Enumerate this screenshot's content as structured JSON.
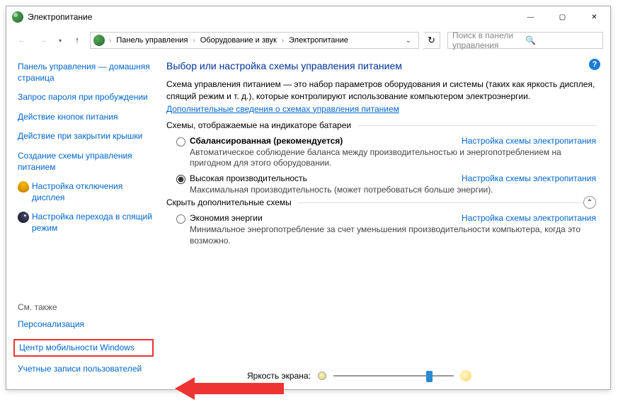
{
  "window_title": "Электропитание",
  "breadcrumb": {
    "items": [
      "Панель управления",
      "Оборудование и звук",
      "Электропитание"
    ]
  },
  "search": {
    "placeholder": "Поиск в панели управления"
  },
  "sidebar": {
    "links": [
      "Панель управления — домашняя страница",
      "Запрос пароля при пробуждении",
      "Действие кнопок питания",
      "Действие при закрытии крышки",
      "Создание схемы управления питанием"
    ],
    "icon_links": [
      "Настройка отключения дисплея",
      "Настройка перехода в спящий режим"
    ],
    "see_also_label": "См. также",
    "see_also_items": [
      "Персонализация",
      "Центр мобильности Windows",
      "Учетные записи пользователей"
    ]
  },
  "main": {
    "title": "Выбор или настройка схемы управления питанием",
    "description": "Схема управления питанием — это набор параметров оборудования и системы (таких как яркость дисплея, спящий режим и т. д.), которые контролируют использование компьютером электроэнергии.",
    "learn_more": "Дополнительные сведения о схемах управления питанием",
    "group1_label": "Схемы, отображаемые на индикаторе батареи",
    "group2_label": "Скрыть дополнительные схемы",
    "plan_link_text": "Настройка схемы электропитания",
    "plans": {
      "balanced": {
        "name": "Сбалансированная (рекомендуется)",
        "desc": "Автоматическое соблюдение баланса между производительностью и энергопотреблением на пригодном для этого оборудовании."
      },
      "high": {
        "name": "Высокая производительность",
        "desc": "Максимальная производительность (может потребоваться больше энергии)."
      },
      "saver": {
        "name": "Экономия энергии",
        "desc": "Минимальное энергопотребление за счет уменьшения производительности компьютера, когда это возможно."
      }
    },
    "brightness_label": "Яркость экрана:",
    "brightness_value_percent": 82
  },
  "titlebar_buttons": {
    "min": "—",
    "max": "▢",
    "close": "✕"
  }
}
